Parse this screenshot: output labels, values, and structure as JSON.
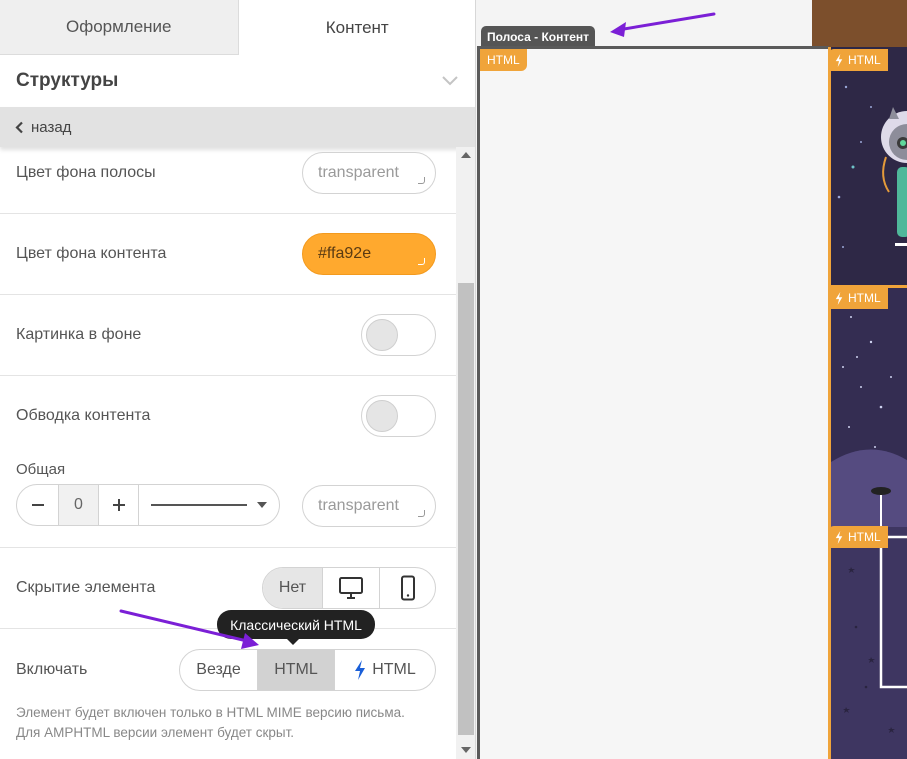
{
  "tabs": {
    "design": "Оформление",
    "content": "Контент"
  },
  "section": {
    "title": "Структуры",
    "back_label": "назад"
  },
  "rows": {
    "stripe_bg": {
      "label": "Цвет фона полосы",
      "value": "transparent"
    },
    "content_bg": {
      "label": "Цвет фона контента",
      "value": "#ffa92e"
    },
    "bg_image": {
      "label": "Картинка в фоне"
    },
    "content_border": {
      "label": "Обводка контента",
      "sub_label": "Общая",
      "width_value": "0",
      "color_value": "transparent"
    },
    "hide_element": {
      "label": "Скрытие элемента",
      "option_none": "Нет"
    },
    "include": {
      "label": "Включать",
      "opt_everywhere": "Везде",
      "opt_html": "HTML",
      "opt_amp": "HTML"
    }
  },
  "tooltip": "Классический HTML",
  "hint": "Элемент будет включен только в HTML MIME версию письма. Для AMPHTML версии элемент будет скрыт.",
  "canvas": {
    "stripe_label": "Полоса - Контент",
    "html_tag": "HTML",
    "amp_tag_1": "HTML",
    "amp_tag_2": "HTML",
    "amp_tag_3": "HTML"
  },
  "colors": {
    "accent_orange": "#ffa92e",
    "arrow_purple": "#7b1fd6",
    "amp_blue": "#1a5fd8"
  }
}
